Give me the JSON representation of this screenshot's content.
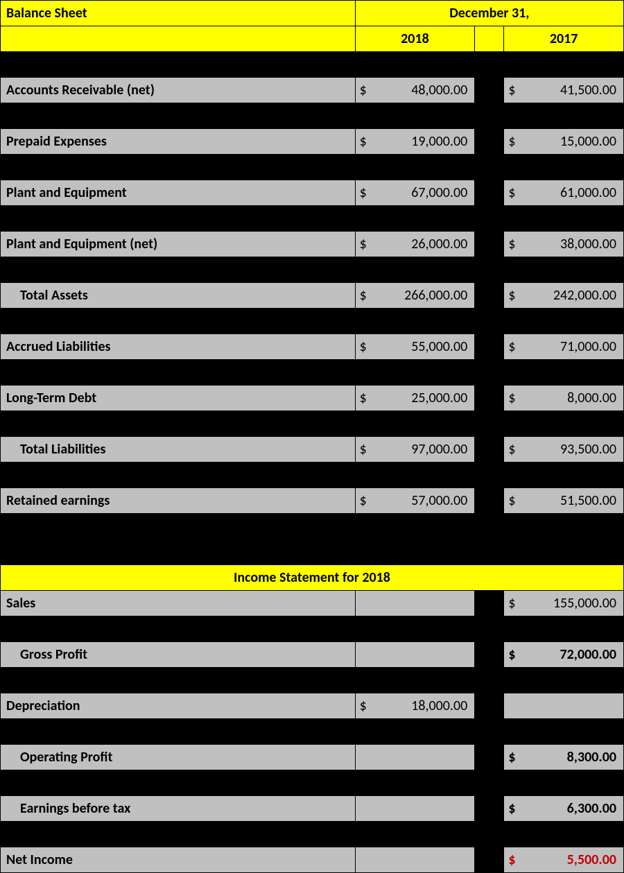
{
  "header": {
    "title": "Balance Sheet",
    "date_header": "December 31,",
    "years": {
      "y1": "2018",
      "y2": "2017"
    }
  },
  "balance_sheet": [
    {
      "label": "Accounts Receivable (net)",
      "indent": false,
      "bold": true,
      "v2018": "48,000.00",
      "v2017": "41,500.00"
    },
    {
      "label": "Prepaid Expenses",
      "indent": false,
      "bold": true,
      "v2018": "19,000.00",
      "v2017": "15,000.00"
    },
    {
      "label": "Plant and Equipment",
      "indent": false,
      "bold": true,
      "v2018": "67,000.00",
      "v2017": "61,000.00"
    },
    {
      "label": "Plant and Equipment (net)",
      "indent": false,
      "bold": true,
      "v2018": "26,000.00",
      "v2017": "38,000.00"
    },
    {
      "label": "Total Assets",
      "indent": true,
      "bold": true,
      "v2018": "266,000.00",
      "v2017": "242,000.00"
    },
    {
      "label": "Accrued Liabilities",
      "indent": false,
      "bold": true,
      "v2018": "55,000.00",
      "v2017": "71,000.00"
    },
    {
      "label": "Long-Term Debt",
      "indent": false,
      "bold": true,
      "v2018": "25,000.00",
      "v2017": "8,000.00"
    },
    {
      "label": "Total Liabilities",
      "indent": true,
      "bold": true,
      "v2018": "97,000.00",
      "v2017": "93,500.00"
    },
    {
      "label": "Retained earnings",
      "indent": false,
      "bold": true,
      "v2018": "57,000.00",
      "v2017": "51,500.00"
    }
  ],
  "income": {
    "title": "Income Statement for 2018",
    "rows": [
      {
        "label": "Sales",
        "indent": false,
        "bold": true,
        "col": "2017",
        "value": "155,000.00",
        "valbold": false
      },
      {
        "label": "Gross Profit",
        "indent": true,
        "bold": true,
        "col": "2017",
        "value": "72,000.00",
        "valbold": true
      },
      {
        "label": "Depreciation",
        "indent": false,
        "bold": true,
        "col": "2018",
        "value": "18,000.00",
        "valbold": false
      },
      {
        "label": "Operating Profit",
        "indent": true,
        "bold": true,
        "col": "2017",
        "value": "8,300.00",
        "valbold": true
      },
      {
        "label": "Earnings before tax",
        "indent": true,
        "bold": true,
        "col": "2017",
        "value": "6,300.00",
        "valbold": true
      },
      {
        "label": "Net Income",
        "indent": false,
        "bold": true,
        "col": "2017",
        "value": "5,500.00",
        "valbold": true,
        "red": true
      }
    ]
  },
  "currency": "$"
}
